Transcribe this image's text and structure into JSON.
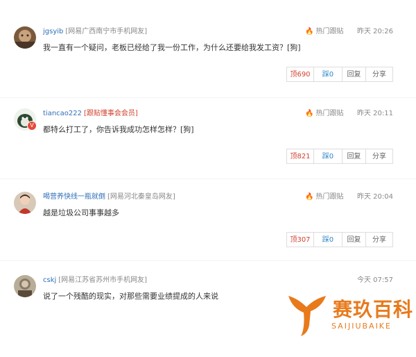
{
  "comments": [
    {
      "username": "jgsyib",
      "location": "[网易广西南宁市手机网友]",
      "badge": "",
      "hot_label": "热门跟贴",
      "time": "昨天 20:26",
      "text": "我一直有一个疑问，老板已经给了我一份工作，为什么还要给我发工资？[狗]",
      "up": "顶690",
      "down": "踩0",
      "reply": "回复",
      "share": "分享",
      "avatar_icon": "avatar-photo"
    },
    {
      "username": "tiancao222",
      "location": "",
      "badge": "[跟贴懂事会会员]",
      "hot_label": "热门跟贴",
      "time": "昨天 20:11",
      "text": "都特么打工了，你告诉我成功怎样怎样？[狗]",
      "up": "顶821",
      "down": "踩0",
      "reply": "回复",
      "share": "分享",
      "avatar_icon": "avatar-bird",
      "vip_badge": "V"
    },
    {
      "username": "喝营养快线一瓶就倒",
      "location": "[网易河北秦皇岛网友]",
      "badge": "",
      "hot_label": "热门跟贴",
      "time": "昨天 20:04",
      "text": "越是垃圾公司事事越多",
      "up": "顶307",
      "down": "踩0",
      "reply": "回复",
      "share": "分享",
      "avatar_icon": "avatar-photo"
    },
    {
      "username": "cskj",
      "location": "[网易江苏省苏州市手机网友]",
      "badge": "",
      "hot_label": "",
      "time": "今天 07:57",
      "text": "说了一个残酷的现实，对那些需要业绩提成的人来说",
      "avatar_icon": "avatar-portrait"
    }
  ],
  "watermark": {
    "name": "赛玖百科",
    "pinyin": "SAIJIUBAIKE",
    "icon": "whale-tail-logo",
    "color": "#e87a1c"
  }
}
